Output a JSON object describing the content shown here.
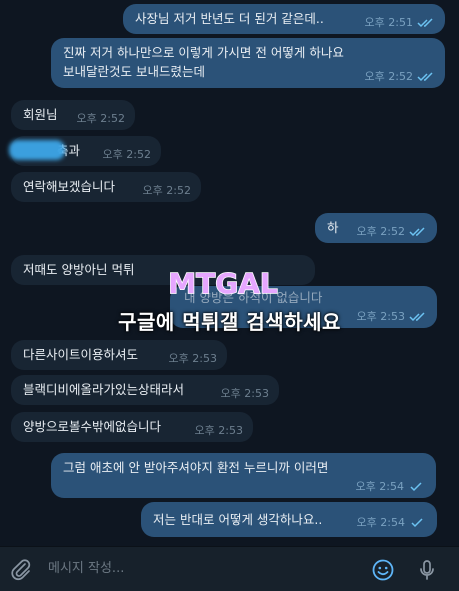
{
  "messages": [
    {
      "text": "사장님 저거 반년도 더 된거 같은데..",
      "time": "오후 2:51",
      "dir": "out",
      "checks": "double"
    },
    {
      "line1": "진짜 저거 하나만으로 이렇게 가시면 전 어떻게 하나요",
      "line2": "보내달란것도 보내드렸는데",
      "time": "오후 2:52",
      "dir": "out",
      "checks": "double"
    },
    {
      "text": "회원님",
      "time": "오후 2:52",
      "dir": "in"
    },
    {
      "text": "축과",
      "time": "오후 2:52",
      "dir": "in"
    },
    {
      "text": "연락해보겠습니다",
      "time": "오후 2:52",
      "dir": "in"
    },
    {
      "text": "하",
      "time": "오후 2:52",
      "dir": "out",
      "checks": "double"
    },
    {
      "text": "저때도 양방아닌 먹튀",
      "time": "",
      "dir": "in"
    },
    {
      "text": "내 양방은 하적이 없습니다",
      "time": "오후 2:53",
      "dir": "out",
      "checks": "double"
    },
    {
      "text": "다른사이트이용하셔도",
      "time": "오후 2:53",
      "dir": "in"
    },
    {
      "text": "블랙디비에올라가있는상태라서",
      "time": "오후 2:53",
      "dir": "in"
    },
    {
      "text": "양방으로볼수밖에없습니다",
      "time": "오후 2:53",
      "dir": "in"
    },
    {
      "text": "그럼 애초에 안 받아주셔야지 환전 누르니까 이러면",
      "time": "오후 2:54",
      "dir": "out",
      "checks": "single"
    },
    {
      "text": "저는 반대로 어떻게 생각하나요..",
      "time": "오후 2:54",
      "dir": "out",
      "checks": "single"
    }
  ],
  "watermark": {
    "logo": "MTGAL",
    "text": "구글에 먹튀갤 검색하세요"
  },
  "composer": {
    "placeholder": "메시지 작성..."
  },
  "colors": {
    "bg": "#0e1621",
    "out": "#2b5278",
    "in": "#182533",
    "check": "#6cc3f2",
    "accent": "#5eb5f7"
  }
}
